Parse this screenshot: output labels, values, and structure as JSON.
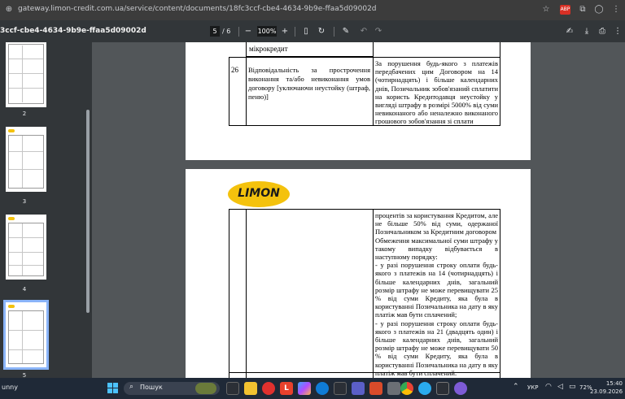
{
  "browser": {
    "url": "gateway.limon-credit.com.ua/service/content/documents/18fc3ccf-cbe4-4634-9b9e-ffaa5d09002d"
  },
  "pdf": {
    "title": "3ccf-cbe4-4634-9b9e-ffaa5d09002d",
    "current_page": "5",
    "total_pages": "/ 6",
    "zoom": "100%"
  },
  "thumbnails": [
    {
      "label": "2"
    },
    {
      "label": "3"
    },
    {
      "label": "4"
    },
    {
      "label": "5",
      "selected": true
    }
  ],
  "page_top": {
    "prev_row_text": "мікрокредит",
    "row_number": "26",
    "row_title": "Відповідальність за прострочення виконання та/або невиконання умов договору [уключаючи неустойку (штраф, пеню)]",
    "row_content": "За порушення будь-якого з платежів передбачених цим Договором на 14 (чотирнадцять) і більше календарних днів, Позичальник зобов'язаний сплатити на користь Кредитодавця неустойку у вигляді штрафу в розмірі 5000% від суми невиконаного або неналежно виконаного грошового зобов'язання зі сплати"
  },
  "page_bottom": {
    "logo_text": "LIMON",
    "continuation": [
      "процентів за користування Кредитом, але не більше 50% від суми, одержаної Позичальником за Кредитним договором",
      "Обмеження максимальної суми штрафу у такому випадку відбувається в наступному порядку:",
      "- у разі порушення строку оплати будь-якого з платежів на 14 (чотирнадцять) і більше календарних днів, загальний розмір штрафу не може перевищувати 25 % від суми Кредиту, яка була в користуванні Позичальника на дату в яку платіж мав бути сплачений;",
      "- у разі порушення строку оплати будь-якого з платежів на 21 (двадцять один) і більше календарних днів, загальний розмір штрафу не може перевищувати 50 % від суми Кредиту, яка була в користуванні Позичальника на дату в яку платіж мав бути сплачений."
    ]
  },
  "taskbar": {
    "left_text": "unny",
    "search_placeholder": "Пошук",
    "language": "УКР",
    "battery": "72%",
    "time": "15:40",
    "date": "23.09.2026"
  },
  "colors": {
    "logo_yellow": "#f4c20d",
    "logo_text": "#1a1a1a",
    "accent_blue": "#8ab4f8"
  }
}
